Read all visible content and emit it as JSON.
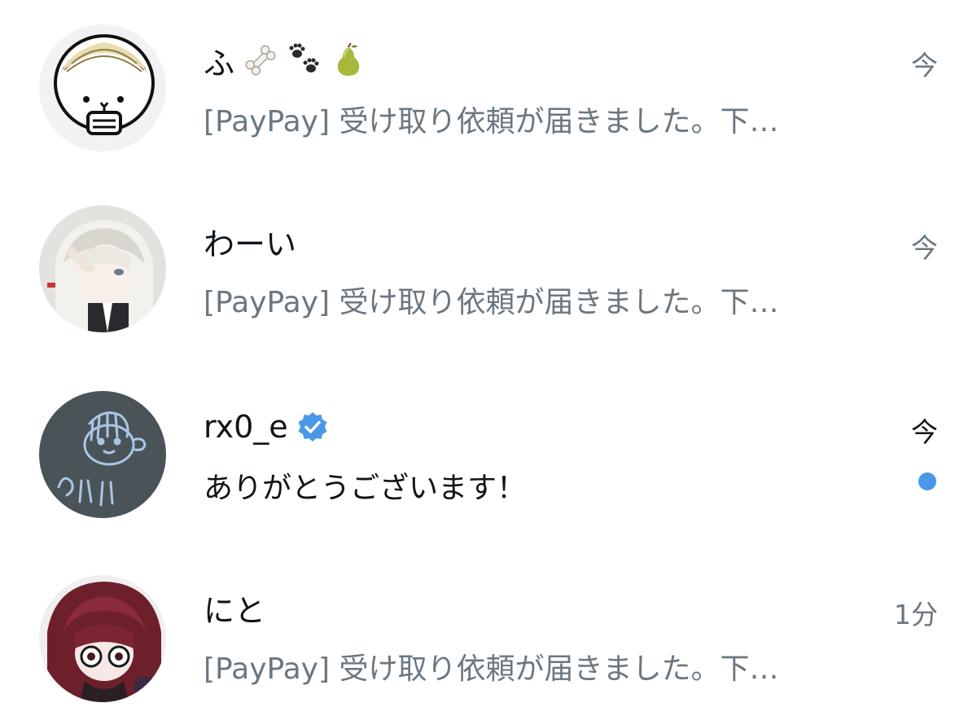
{
  "conversations": [
    {
      "name": "ふ",
      "name_emojis": [
        "bone-emoji",
        "paw-prints-emoji",
        "pear-emoji"
      ],
      "preview": "[PayPay] 受け取り依頼が届きました。下…",
      "time": "今",
      "verified": false,
      "unread": false,
      "avatar": "noodle-bowl-character-avatar"
    },
    {
      "name": "わーい",
      "name_emojis": [],
      "preview": "[PayPay] 受け取り依頼が届きました。下…",
      "time": "今",
      "verified": false,
      "unread": false,
      "avatar": "anime-white-hair-avatar"
    },
    {
      "name": "rx0_e",
      "name_emojis": [],
      "preview": "ありがとうございます！",
      "time": "今",
      "verified": true,
      "unread": true,
      "avatar": "chalkboard-doodle-avatar"
    },
    {
      "name": "にと",
      "name_emojis": [],
      "preview": "[PayPay] 受け取り依頼が届きました。下…",
      "time": "1分",
      "verified": false,
      "unread": false,
      "avatar": "anime-red-hair-avatar"
    }
  ],
  "colors": {
    "text_primary": "#0f1419",
    "text_secondary": "#6b7780",
    "verified_blue": "#4a97e8",
    "unread_dot": "#4a97e8"
  }
}
